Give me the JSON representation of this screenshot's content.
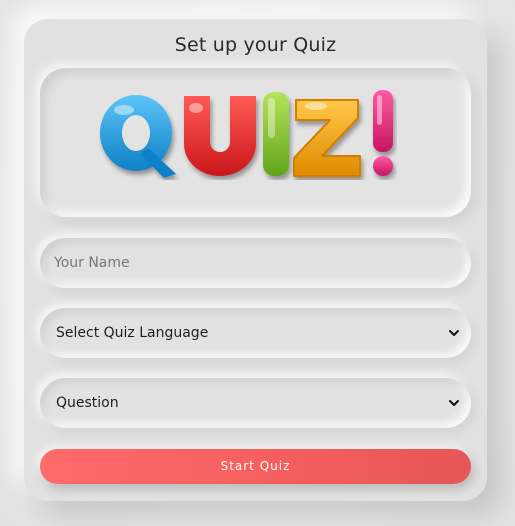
{
  "card": {
    "title": "Set up your Quiz",
    "banner": {
      "logo_letters": [
        "Q",
        "U",
        "I",
        "Z",
        "!"
      ],
      "logo_colors": [
        "#1a93dc",
        "#e3262a",
        "#86c52a",
        "#f2a112",
        "#e3237b"
      ]
    },
    "name_field": {
      "placeholder": "Your Name",
      "value": ""
    },
    "language_select": {
      "selected": "Select Quiz Language",
      "icon": "chevron-down-icon"
    },
    "question_select": {
      "selected": "Question",
      "icon": "chevron-down-icon"
    },
    "start_button": {
      "label": "Start Quiz",
      "color": "#ff6b6b"
    }
  }
}
